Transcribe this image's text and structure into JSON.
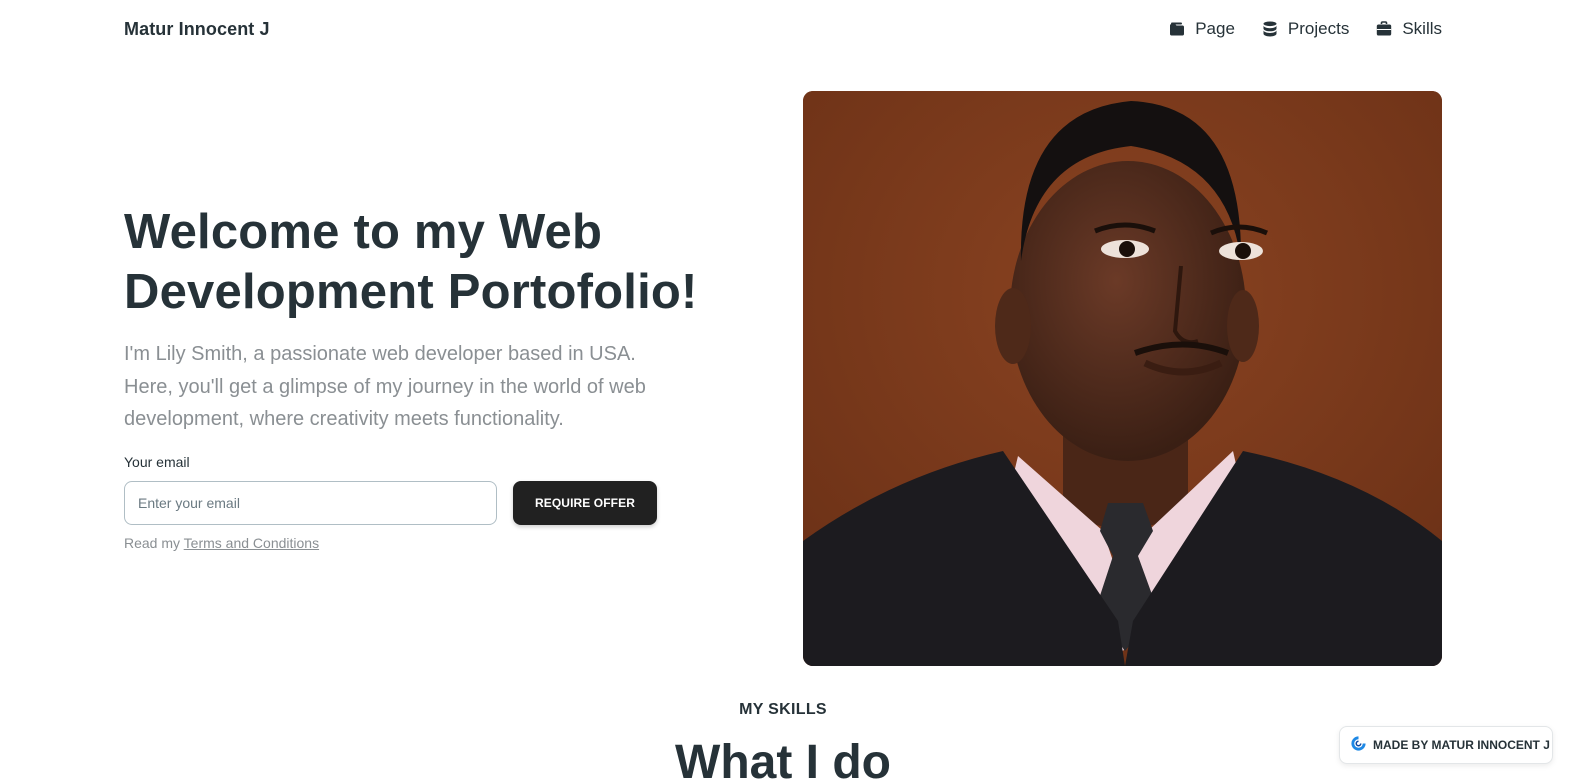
{
  "nav": {
    "brand": "Matur Innocent J",
    "links": [
      {
        "label": "Page",
        "icon": "folder-icon"
      },
      {
        "label": "Projects",
        "icon": "database-icon"
      },
      {
        "label": "Skills",
        "icon": "briefcase-icon"
      }
    ]
  },
  "hero": {
    "title": "Welcome to my Web Development Portofolio!",
    "description": "I'm Lily Smith, a passionate web developer based in USA. Here, you'll get a glimpse of my journey in the world of web development, where creativity meets functionality.",
    "email_label": "Your email",
    "email_placeholder": "Enter your email",
    "email_value": "",
    "button_label": "REQUIRE OFFER",
    "terms_prefix": "Read my",
    "terms_link": "Terms and Conditions"
  },
  "portrait": {
    "alt": "portrait photo"
  },
  "skills": {
    "eyebrow": "MY SKILLS",
    "title": "What I do"
  },
  "badge": {
    "label": "MADE BY MATUR INNOCENT J",
    "icon": "logo-icon"
  },
  "colors": {
    "text": "#263238",
    "muted": "#8a8f93",
    "button": "#212121",
    "portrait_bg": "#7a3a1c"
  }
}
